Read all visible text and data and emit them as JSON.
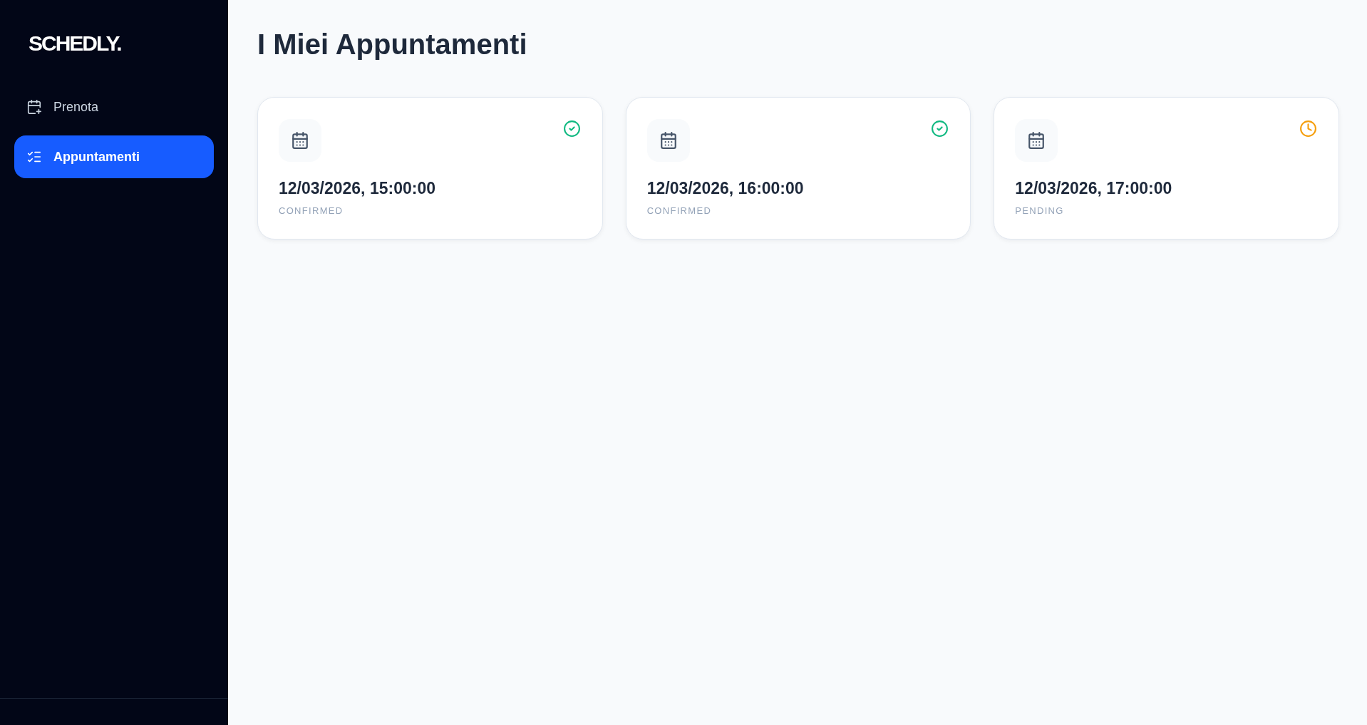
{
  "sidebar": {
    "logo": "SCHEDLY.",
    "items": [
      {
        "label": "Prenota",
        "selected": false
      },
      {
        "label": "Appuntamenti",
        "selected": true
      }
    ]
  },
  "main": {
    "title": "I Miei Appuntamenti",
    "appointments": [
      {
        "datetime": "12/03/2026, 15:00:00",
        "status": "CONFIRMED",
        "kind": "confirmed"
      },
      {
        "datetime": "12/03/2026, 16:00:00",
        "status": "CONFIRMED",
        "kind": "confirmed"
      },
      {
        "datetime": "12/03/2026, 17:00:00",
        "status": "PENDING",
        "kind": "pending"
      }
    ]
  }
}
